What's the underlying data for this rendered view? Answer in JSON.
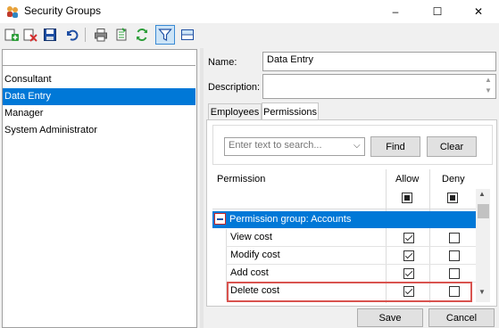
{
  "window": {
    "title": "Security Groups",
    "minimize": "–",
    "maximize": "☐",
    "close": "✕"
  },
  "toolbar": {
    "buttons": [
      "add-icon",
      "delete-icon",
      "save-icon",
      "undo-icon",
      "print-icon",
      "export-icon",
      "refresh-icon",
      "filter-icon",
      "view-icon"
    ]
  },
  "groups": [
    "Consultant",
    "Data Entry",
    "Manager",
    "System Administrator"
  ],
  "selected_group": "Data Entry",
  "form": {
    "name_label": "Name:",
    "name_value": "Data Entry",
    "description_label": "Description:",
    "description_value": ""
  },
  "tabs": [
    "Employees",
    "Permissions"
  ],
  "active_tab": "Permissions",
  "search": {
    "placeholder": "Enter text to search...",
    "find_label": "Find",
    "clear_label": "Clear"
  },
  "grid": {
    "columns": [
      "Permission",
      "Allow",
      "Deny"
    ],
    "group_row": "Permission group: Accounts",
    "rows": [
      {
        "label": "View cost",
        "allow": true,
        "deny": false
      },
      {
        "label": "Modify cost",
        "allow": true,
        "deny": false
      },
      {
        "label": "Add cost",
        "allow": true,
        "deny": false
      },
      {
        "label": "Delete cost",
        "allow": true,
        "deny": false
      }
    ]
  },
  "footer": {
    "save_label": "Save",
    "cancel_label": "Cancel"
  },
  "colors": {
    "selection": "#0078d7",
    "highlight_border": "#d9534f"
  }
}
